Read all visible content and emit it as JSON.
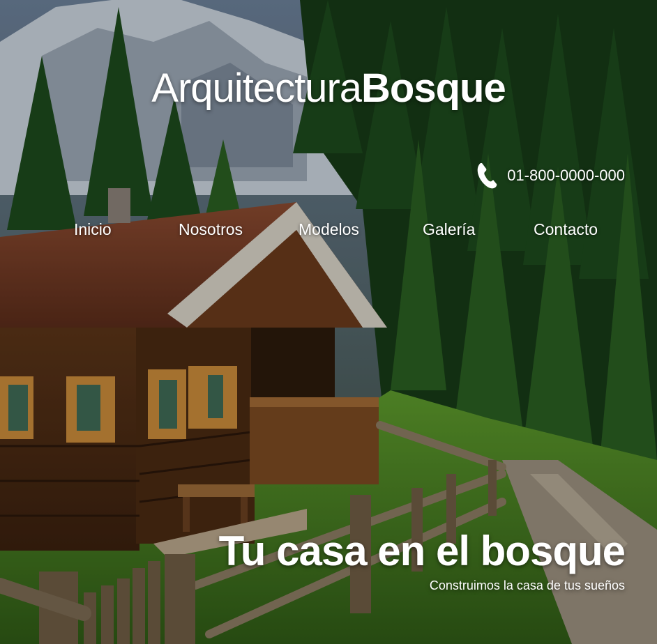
{
  "brand": {
    "light": "Arquitectura",
    "bold": "Bosque"
  },
  "contact": {
    "phone": "01-800-0000-000",
    "icon": "phone-icon"
  },
  "nav": {
    "items": [
      {
        "label": "Inicio"
      },
      {
        "label": "Nosotros"
      },
      {
        "label": "Modelos"
      },
      {
        "label": "Galería"
      },
      {
        "label": "Contacto"
      }
    ]
  },
  "hero": {
    "headline": "Tu casa en el bosque",
    "subheadline": "Construimos la casa de tus sueños"
  },
  "colors": {
    "text": "#ffffff",
    "forest": "#1f4a1f",
    "grass": "#4f8a2a",
    "wood": "#6b3f1f"
  }
}
